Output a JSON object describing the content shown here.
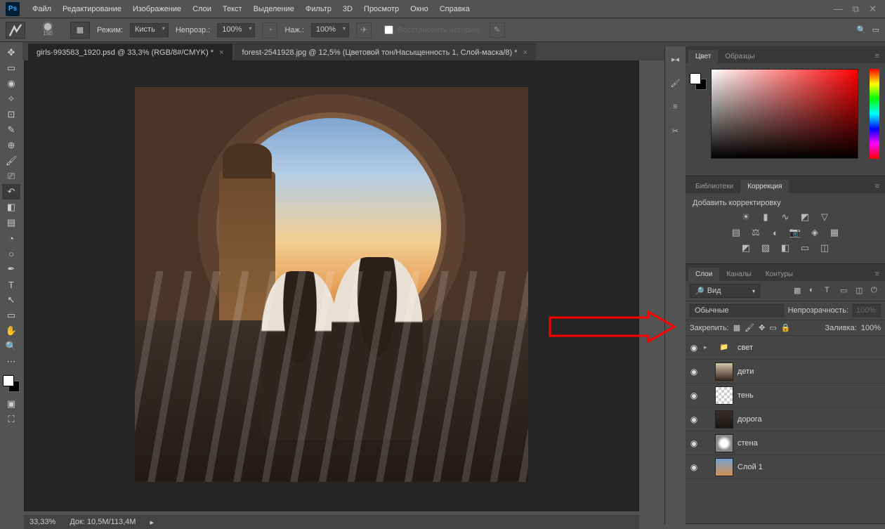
{
  "menu": [
    "Файл",
    "Редактирование",
    "Изображение",
    "Слои",
    "Текст",
    "Выделение",
    "Фильтр",
    "3D",
    "Просмотр",
    "Окно",
    "Справка"
  ],
  "options": {
    "brush_size": "150",
    "mode_label": "Режим:",
    "mode_value": "Кисть",
    "opacity_label": "Непрозр.:",
    "opacity_value": "100%",
    "flow_label": "Наж.:",
    "flow_value": "100%",
    "history_placeholder": "Восстановить историю"
  },
  "tabs": [
    {
      "label": "girls-993583_1920.psd @ 33,3% (RGB/8#/CMYK) *",
      "active": true
    },
    {
      "label": "forest-2541928.jpg @ 12,5% (Цветовой тон/Насыщенность 1, Слой-маска/8) *",
      "active": false
    }
  ],
  "status": {
    "zoom": "33,33%",
    "doc": "Док: 10,5M/113,4M"
  },
  "panels": {
    "color_tabs": [
      "Цвет",
      "Образцы"
    ],
    "lib_tabs": [
      "Библиотеки",
      "Коррекция"
    ],
    "corr_title": "Добавить корректировку",
    "layer_tabs": [
      "Слои",
      "Каналы",
      "Контуры"
    ],
    "layer_filter": "Вид",
    "blend_mode": "Обычные",
    "opacity_label": "Непрозрачность:",
    "opacity_val": "100%",
    "lock_label": "Закрепить:",
    "fill_label": "Заливка:",
    "fill_val": "100%"
  },
  "layers": [
    {
      "name": "свет",
      "type": "folder"
    },
    {
      "name": "дети",
      "type": "image"
    },
    {
      "name": "тень",
      "type": "transparent"
    },
    {
      "name": "дорога",
      "type": "image"
    },
    {
      "name": "стена",
      "type": "image"
    },
    {
      "name": "Слой 1",
      "type": "image"
    }
  ]
}
